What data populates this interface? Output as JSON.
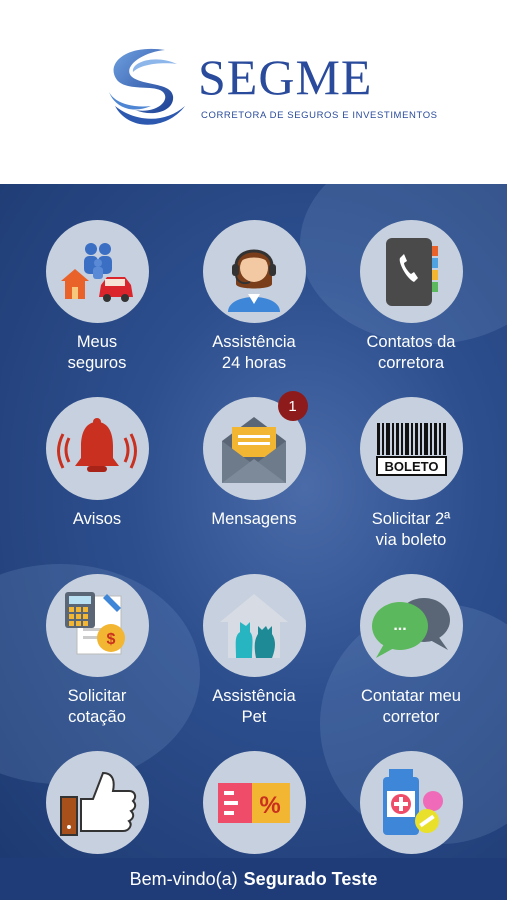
{
  "header": {
    "brand_name": "SEGME",
    "tagline": "CORRETORA DE SEGUROS E INVESTIMENTOS"
  },
  "tiles": [
    {
      "label_line1": "Meus",
      "label_line2": "seguros",
      "icon": "family-house-car-icon"
    },
    {
      "label_line1": "Assistência",
      "label_line2": "24 horas",
      "icon": "headset-agent-icon"
    },
    {
      "label_line1": "Contatos da",
      "label_line2": "corretora",
      "icon": "phone-book-icon"
    },
    {
      "label_line1": "Avisos",
      "label_line2": "",
      "icon": "alarm-bell-icon"
    },
    {
      "label_line1": "Mensagens",
      "label_line2": "",
      "icon": "envelope-icon",
      "badge": "1"
    },
    {
      "label_line1": "Solicitar 2ª",
      "label_line2": "via boleto",
      "icon": "barcode-boleto-icon",
      "icon_text": "BOLETO"
    },
    {
      "label_line1": "Solicitar",
      "label_line2": "cotação",
      "icon": "calculator-document-icon"
    },
    {
      "label_line1": "Assistência",
      "label_line2": "Pet",
      "icon": "pet-house-icon"
    },
    {
      "label_line1": "Contatar meu",
      "label_line2": "corretor",
      "icon": "chat-bubbles-icon",
      "icon_text": "..."
    },
    {
      "label_line1": "",
      "label_line2": "",
      "icon": "thumbs-up-icon"
    },
    {
      "label_line1": "",
      "label_line2": "",
      "icon": "discount-ticket-icon",
      "icon_text": "%"
    },
    {
      "label_line1": "",
      "label_line2": "",
      "icon": "medicine-icon"
    }
  ],
  "footer": {
    "welcome": "Bem-vindo(a)",
    "user_name": "Segurado Teste"
  },
  "colors": {
    "brand_blue": "#2a4b9b",
    "background_blue": "#2d4f8e",
    "circle_bg": "#c7d0de",
    "badge_red": "#8e1b1b",
    "footer_blue": "#1f3c78"
  }
}
